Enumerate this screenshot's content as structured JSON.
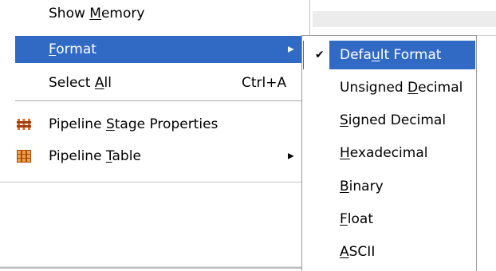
{
  "main_menu": {
    "items": [
      {
        "pre": "Show ",
        "mn": "M",
        "post": "emory"
      },
      {
        "pre": "",
        "mn": "F",
        "post": "ormat"
      },
      {
        "pre": "Select ",
        "mn": "A",
        "post": "ll",
        "shortcut": "Ctrl+A"
      },
      {
        "pre": "Pipeline ",
        "mn": "S",
        "post": "tage Properties"
      },
      {
        "pre": "Pipeline ",
        "mn": "T",
        "post": "able"
      }
    ]
  },
  "format_submenu": {
    "items": [
      {
        "pre": "Defa",
        "mn": "u",
        "post": "lt Format"
      },
      {
        "pre": "Unsigned ",
        "mn": "D",
        "post": "ecimal"
      },
      {
        "pre": "",
        "mn": "S",
        "post": "igned Decimal"
      },
      {
        "pre": "",
        "mn": "H",
        "post": "exadecimal"
      },
      {
        "pre": "",
        "mn": "B",
        "post": "inary"
      },
      {
        "pre": "",
        "mn": "F",
        "post": "loat"
      },
      {
        "pre": "",
        "mn": "A",
        "post": "SCII"
      }
    ]
  },
  "icons": {
    "pipeline_stage": "pipeline-stage-properties-icon",
    "pipeline_table": "pipeline-table-icon",
    "submenu_arrow": "submenu-arrow-icon",
    "check": "checkmark-icon"
  },
  "colors": {
    "selection_bg": "#316ac5",
    "selection_fg": "#ffffff",
    "icon_orange": "#d8722c"
  }
}
